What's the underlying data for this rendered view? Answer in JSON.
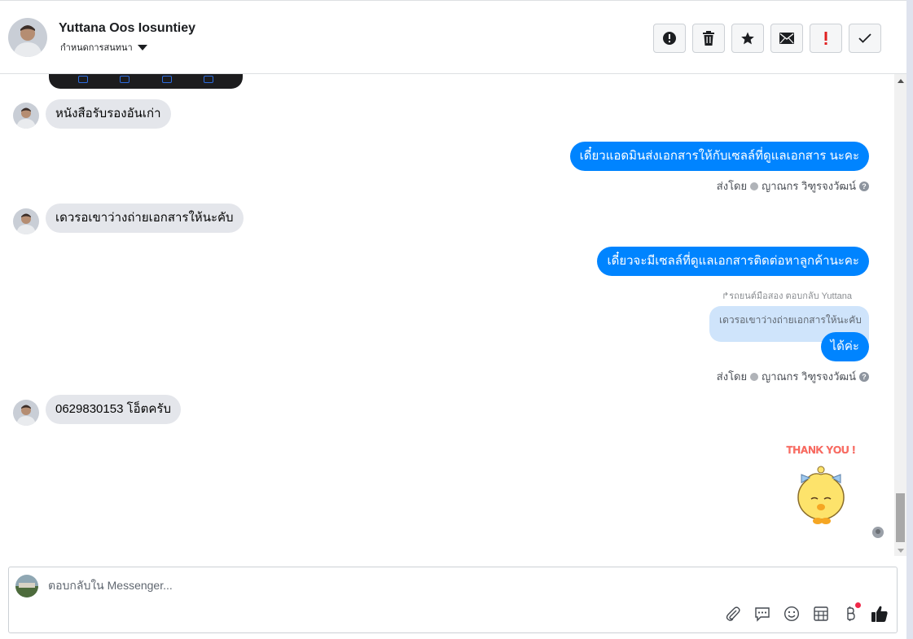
{
  "header": {
    "contact_name": "Yuttana Oos Iosuntiey",
    "subtitle": "กำหนดการสนทนา",
    "toolbar": [
      {
        "name": "alert-circle-button",
        "icon": "alert-circle-icon"
      },
      {
        "name": "delete-button",
        "icon": "trash-icon"
      },
      {
        "name": "star-button",
        "icon": "star-icon"
      },
      {
        "name": "mark-unread-button",
        "icon": "envelope-icon"
      },
      {
        "name": "important-button",
        "icon": "exclamation-icon",
        "color": "#e02020"
      },
      {
        "name": "mark-done-button",
        "icon": "check-icon"
      }
    ]
  },
  "messages": {
    "m1": "หนังสือรับรองอันเก่า",
    "m2": "เดี๋ยวแอดมินส่งเอกสารให้กับเซลล์ที่ดูแลเอกสาร นะคะ",
    "sent_by_1": {
      "label": "ส่งโดย",
      "name": "ญาณกร วิฑูรจงวัฒน์"
    },
    "m3": "เดวรอเขาว่างถ่ายเอกสารให้นะคับ",
    "m4": "เดี๋ยวจะมีเซลล์ที่ดูแลเอกสารติดต่อหาลูกค้านะคะ",
    "reply_note": "↱รถยนต์มือสอง ตอบกลับ Yuttana",
    "reply_quote": "เดวรอเขาว่างถ่ายเอกสารให้นะคับ",
    "m5": "ได้ค่ะ",
    "sent_by_2": {
      "label": "ส่งโดย",
      "name": "ญาณกร วิฑูรจงวัฒน์"
    },
    "m6": "0629830153 โอ็ตครับ",
    "sticker_text": "THANK YOU !"
  },
  "composer": {
    "placeholder": "ตอบกลับใน Messenger...",
    "tools": [
      "paperclip-icon",
      "quick-reply-icon",
      "emoji-icon",
      "appointment-icon",
      "payment-icon",
      "like-icon"
    ]
  },
  "colors": {
    "outgoing_bubble": "#0084ff",
    "incoming_bubble": "#e4e6eb",
    "reply_quote": "#cfe4fb"
  }
}
